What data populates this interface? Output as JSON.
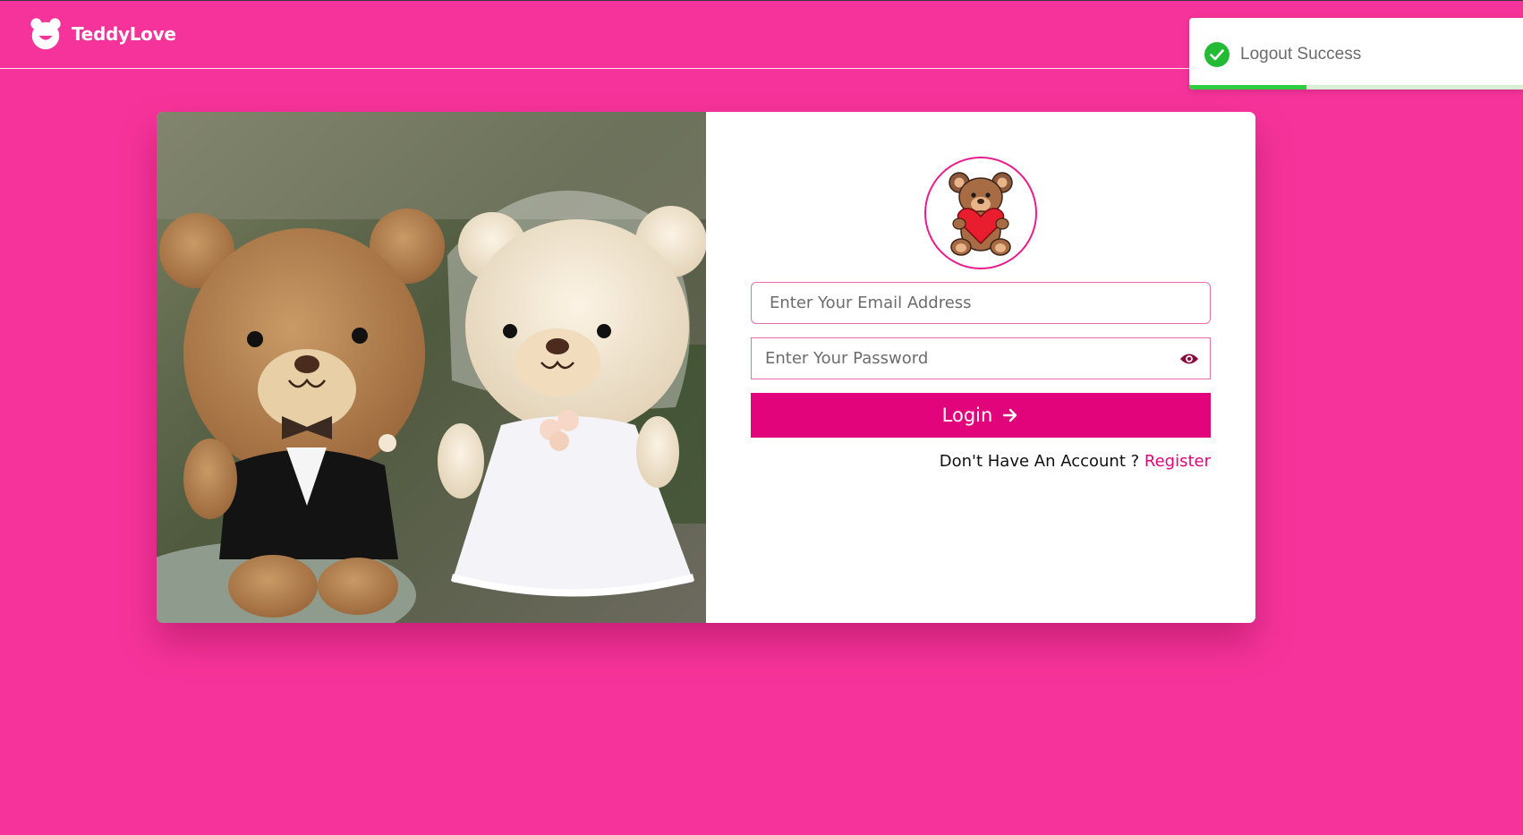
{
  "app": {
    "brand_name": "TeddyLove"
  },
  "toast": {
    "message": "Logout Success",
    "progress_fraction": 0.35,
    "colors": {
      "progress": "#2ecc40",
      "icon": "#22bb33"
    }
  },
  "login_form": {
    "email_placeholder": "Enter Your Email Address",
    "password_placeholder": "Enter Your Password",
    "login_label": "Login",
    "no_account_text": "Don't Have An Account ?",
    "register_label": "Register"
  },
  "icons": {
    "brand": "bear-logo-icon",
    "toast": "check-circle-icon",
    "password_toggle": "eye-icon",
    "login": "arrow-right-icon",
    "avatar": "teddy-bear-heart-icon"
  },
  "colors": {
    "background": "#f6339a",
    "accent": "#e2047a",
    "card": "#ffffff"
  }
}
